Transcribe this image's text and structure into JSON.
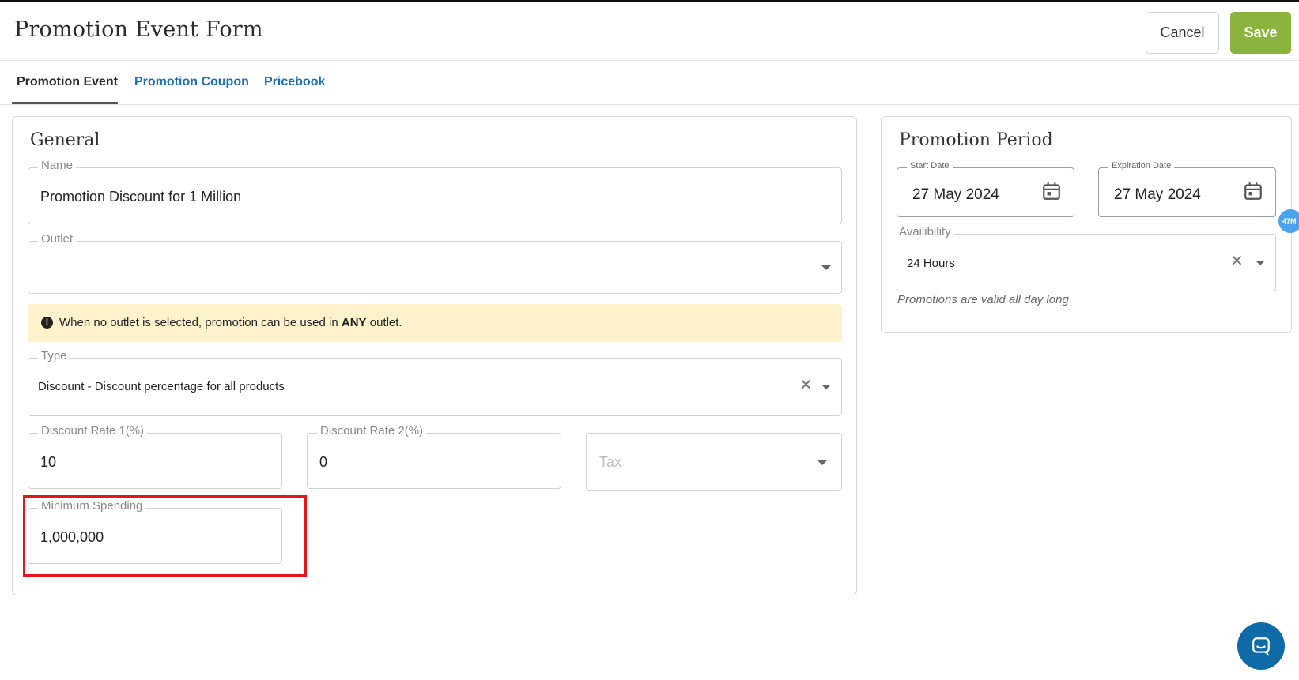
{
  "header": {
    "title": "Promotion Event Form",
    "cancel_label": "Cancel",
    "save_label": "Save"
  },
  "tabs": [
    {
      "label": "Promotion Event",
      "active": true
    },
    {
      "label": "Promotion Coupon",
      "active": false
    },
    {
      "label": "Pricebook",
      "active": false
    }
  ],
  "general": {
    "title": "General",
    "name": {
      "label": "Name",
      "value": "Promotion Discount for 1 Million"
    },
    "outlet": {
      "label": "Outlet",
      "value": ""
    },
    "alert": {
      "prefix": "When no outlet is selected, promotion can be used in ",
      "emphasis": "ANY",
      "suffix": " outlet."
    },
    "type": {
      "label": "Type",
      "value": "Discount - Discount percentage for all products"
    },
    "discount_rate_1": {
      "label": "Discount Rate 1(%)",
      "value": "10"
    },
    "discount_rate_2": {
      "label": "Discount Rate 2(%)",
      "value": "0"
    },
    "tax": {
      "placeholder": "Tax"
    },
    "minimum_spending": {
      "label": "Minimum Spending",
      "value": "1,000,000"
    }
  },
  "period": {
    "title": "Promotion Period",
    "start_date": {
      "label": "Start Date",
      "value": "27 May 2024"
    },
    "expiration_date": {
      "label": "Expiration Date",
      "value": "27 May 2024"
    },
    "availability": {
      "label": "Availibility",
      "value": "24 Hours",
      "helper": "Promotions are valid all day long"
    }
  },
  "side_badge": "47M",
  "colors": {
    "save_button": "#8bb33d",
    "tab_link": "#1f6fb3",
    "alert_background": "#fdf2cc",
    "highlight_border": "#e8141c",
    "chat_bubble": "#0f6aa8",
    "side_badge": "#4aa3f0"
  },
  "icons": {
    "alert": "info-circle-icon",
    "date": "calendar-icon",
    "clear": "close-icon",
    "dropdown": "caret-down-icon",
    "chat": "chat-icon"
  }
}
